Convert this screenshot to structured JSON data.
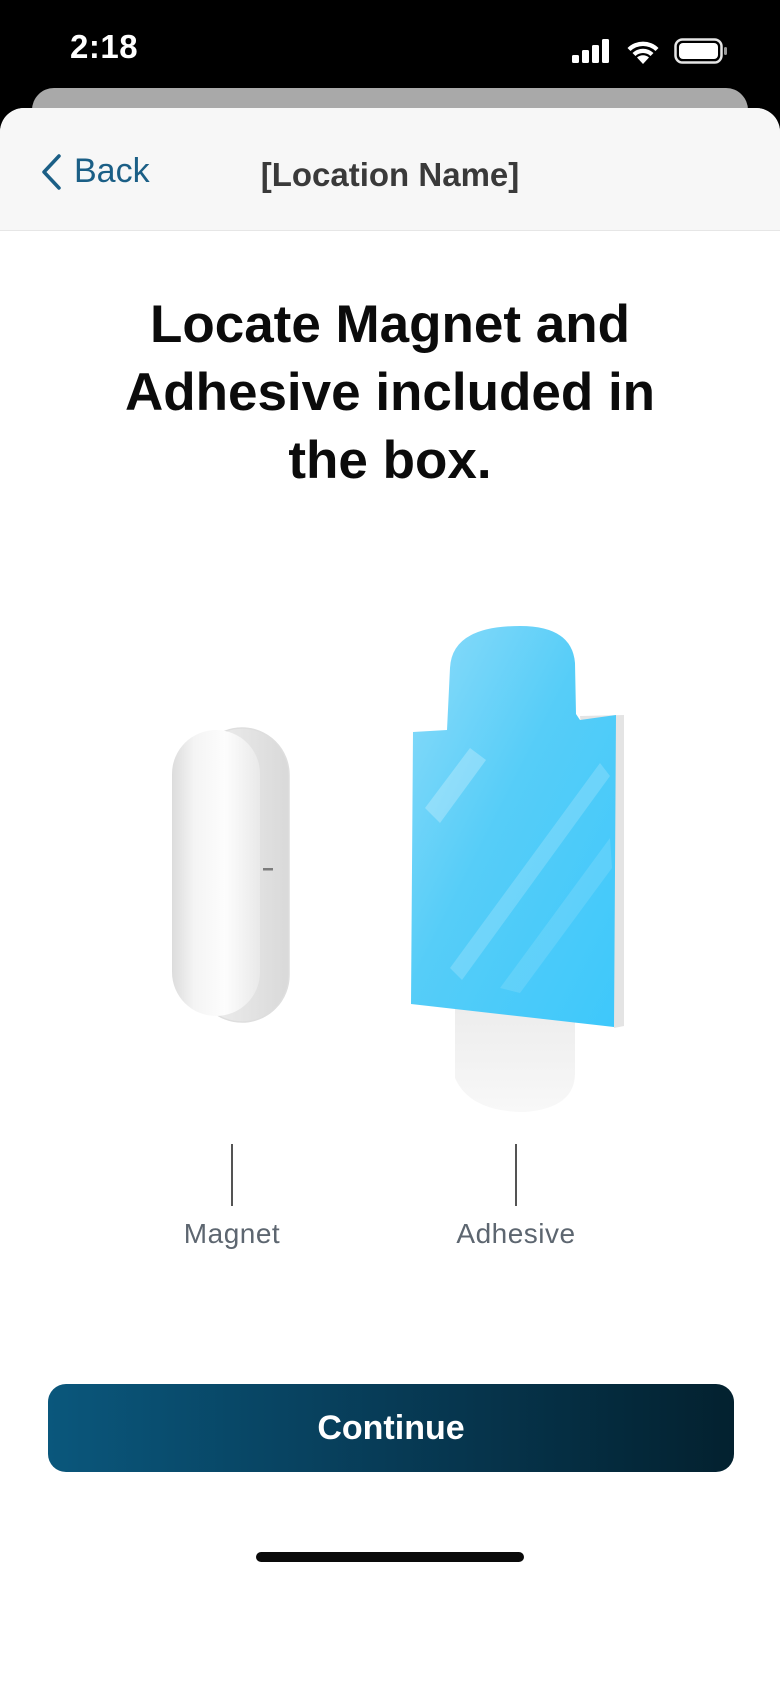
{
  "status_bar": {
    "time": "2:18",
    "icons": [
      "cellular-signal-icon",
      "wifi-icon",
      "battery-icon"
    ]
  },
  "nav": {
    "back_label": "Back",
    "title": "[Location Name]"
  },
  "heading": "Locate Magnet and Adhesive included in the box.",
  "items": [
    {
      "label": "Magnet",
      "icon": "magnet-illustration"
    },
    {
      "label": "Adhesive",
      "icon": "adhesive-illustration"
    }
  ],
  "continue_label": "Continue",
  "colors": {
    "accent": "#1b5f86",
    "button_start": "#0a577c",
    "button_end": "#03212f",
    "adhesive_blue": "#47cdfb"
  }
}
